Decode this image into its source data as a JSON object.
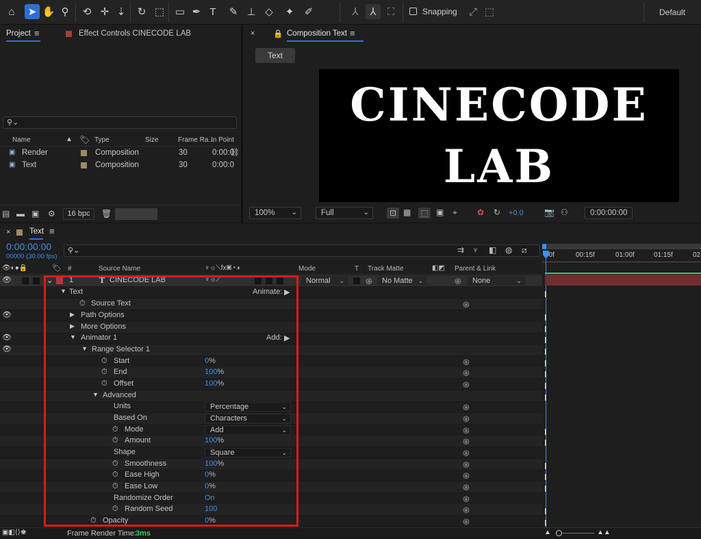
{
  "toolbar": {
    "snapping_label": "Snapping",
    "workspace_label": "Default",
    "icons": [
      "home-icon",
      "selection-arrow-icon",
      "hand-icon",
      "zoom-icon",
      "orbit-icon",
      "pan-icon",
      "dolly-icon",
      "rotate-icon",
      "anchor-icon",
      "rectangle-icon",
      "pen-icon",
      "type-icon",
      "brush-icon",
      "stamp-icon",
      "eraser-icon",
      "roto-icon",
      "puppet-icon"
    ]
  },
  "project_panel": {
    "tab_project": "Project",
    "tab_effect": "Effect Controls CINECODE LAB",
    "columns": {
      "name": "Name",
      "type": "Type",
      "size": "Size",
      "frame_rate": "Frame Ra...",
      "in_point": "In Point"
    },
    "rows": [
      {
        "name": "Render",
        "type": "Composition",
        "frame_rate": "30",
        "in_point": "0:00:0"
      },
      {
        "name": "Text",
        "type": "Composition",
        "frame_rate": "30",
        "in_point": "0:00:0"
      }
    ],
    "bpc": "16 bpc"
  },
  "composition_panel": {
    "tab_label": "Composition Text",
    "breadcrumb": "Text",
    "canvas_line1": "CINECODE",
    "canvas_line2": "LAB",
    "zoom": "100%",
    "resolution": "Full",
    "exposure": "+0.0",
    "timecode": "0:00:00:00"
  },
  "timeline": {
    "tab_label": "Text",
    "timecode": "0:00:00:00",
    "fps": "00000 (30.00 fps)",
    "headers": {
      "hash": "#",
      "source_name": "Source Name",
      "mode": "Mode",
      "t": "T",
      "track_matte": "Track Matte",
      "parent": "Parent & Link"
    },
    "ruler": [
      "00f",
      "00:15f",
      "01:00f",
      "01:15f",
      "02"
    ],
    "layer": {
      "index": "1",
      "name": "CINECODE LAB",
      "mode": "Normal",
      "matte": "No Matte",
      "parent": "None"
    },
    "rows": {
      "text": "Text",
      "animate": "Animate:",
      "source_text": "Source Text",
      "path_options": "Path Options",
      "more_options": "More Options",
      "animator": "Animator 1",
      "add": "Add:",
      "range_selector": "Range Selector 1",
      "start": "Start",
      "start_val": "0",
      "start_unit": "%",
      "end": "End",
      "end_val": "100",
      "end_unit": "%",
      "offset": "Offset",
      "offset_val": "100",
      "offset_unit": "%",
      "advanced": "Advanced",
      "units": "Units",
      "units_val": "Percentage",
      "based_on": "Based On",
      "based_on_val": "Characters",
      "mode": "Mode",
      "mode_val": "Add",
      "amount": "Amount",
      "amount_val": "100",
      "amount_unit": "%",
      "shape": "Shape",
      "shape_val": "Square",
      "smoothness": "Smoothness",
      "smoothness_val": "100",
      "smoothness_unit": "%",
      "ease_high": "Ease High",
      "ease_high_val": "0",
      "ease_high_unit": "%",
      "ease_low": "Ease Low",
      "ease_low_val": "0",
      "ease_low_unit": "%",
      "randomize": "Randomize Order",
      "randomize_val": "On",
      "random_seed": "Random Seed",
      "random_seed_val": "100",
      "opacity": "Opacity",
      "opacity_val": "0",
      "opacity_unit": "%"
    },
    "footer_label": "Frame Render Time:",
    "footer_value": "3ms"
  },
  "colors": {
    "accent": "#2d6fd6",
    "highlight": "#e0191a",
    "value_blue": "#3d8ff3",
    "layer_bar": "#6b2f2f"
  }
}
